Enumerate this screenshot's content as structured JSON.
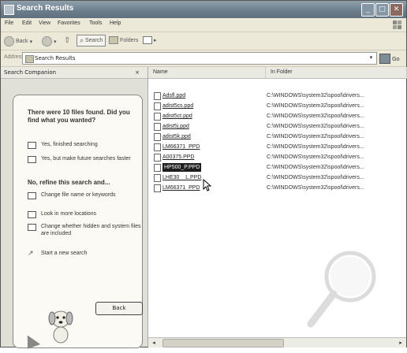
{
  "window": {
    "title": "Search Results"
  },
  "menu": [
    "File",
    "Edit",
    "View",
    "Favorites",
    "Tools",
    "Help"
  ],
  "toolbar": {
    "back": "Back",
    "search": "Search",
    "folders": "Folders"
  },
  "address": {
    "label": "Address",
    "value": "Search Results",
    "go": "Go"
  },
  "pane": {
    "title": "Search Companion",
    "close": "×",
    "question": "There were 10 files found. Did you find what you wanted?",
    "opt_finished": "Yes, finished searching",
    "opt_faster": "Yes, but make future searches faster",
    "refine": "No, refine this search and...",
    "opt_change": "Change file name or keywords",
    "opt_more": "Look in more locations",
    "opt_hidden": "Change whether hidden and system files are included",
    "opt_new": "Start a new search",
    "back_button": "Back"
  },
  "columns": {
    "name": "Name",
    "folder": "In Folder"
  },
  "files": [
    {
      "name": "Adsfl.ppd",
      "folder": "C:\\WINDOWS\\system32\\spool\\drivers..."
    },
    {
      "name": "adist5cs.ppd",
      "folder": "C:\\WINDOWS\\system32\\spool\\drivers..."
    },
    {
      "name": "adist5ct.ppd",
      "folder": "C:\\WINDOWS\\system32\\spool\\drivers..."
    },
    {
      "name": "adist5j.ppd",
      "folder": "C:\\WINDOWS\\system32\\spool\\drivers..."
    },
    {
      "name": "adist5k.ppd",
      "folder": "C:\\WINDOWS\\system32\\spool\\drivers..."
    },
    {
      "name": "LM66371_PPD",
      "folder": "C:\\WINDOWS\\system32\\spool\\drivers..."
    },
    {
      "name": "A00375.PPD",
      "folder": "C:\\WINDOWS\\system32\\spool\\drivers..."
    },
    {
      "name": "HP500_P.PPD",
      "folder": "C:\\WINDOWS\\system32\\spool\\drivers..."
    },
    {
      "name": "LHE30__L.PPD",
      "folder": "C:\\WINDOWS\\system32\\spool\\drivers..."
    },
    {
      "name": "LM66371_PPD",
      "folder": "C:\\WINDOWS\\system32\\spool\\drivers..."
    }
  ],
  "selected_index": 7
}
